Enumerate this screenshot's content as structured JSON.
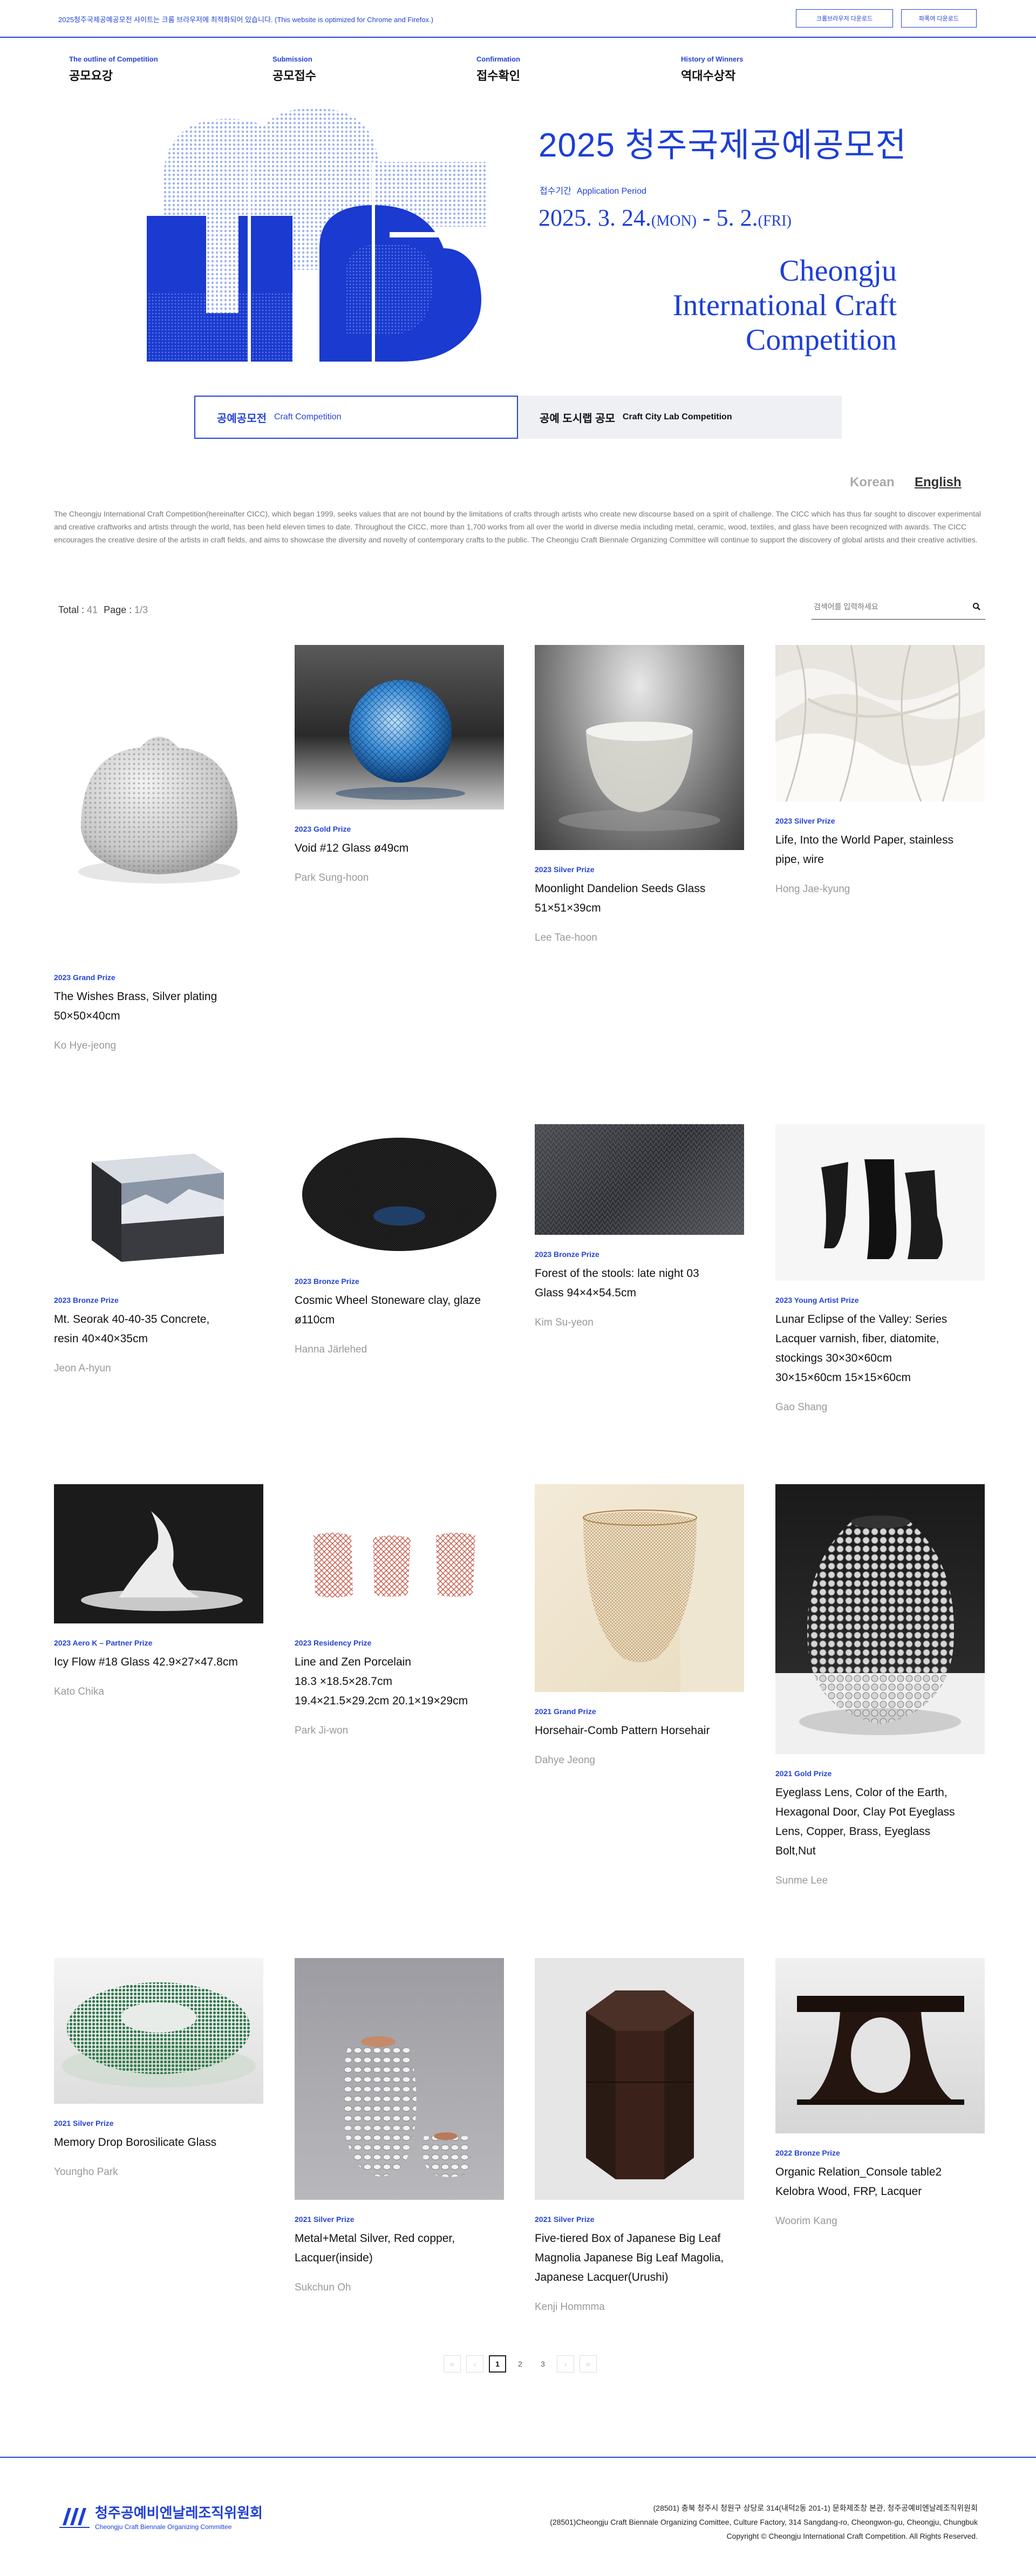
{
  "topbar": {
    "notice": "2025청주국제공예공모전 사이트는 크롬 브라우저에 최적화되어 있습니다. (This website is optimized for Chrome and Firefox.)",
    "download_chrome": "크롬브라우저 다운로드",
    "download_firefox": "파폭여 다운로드"
  },
  "nav": [
    {
      "en": "The outline of Competition",
      "ko": "공모요강"
    },
    {
      "en": "Submission",
      "ko": "공모접수"
    },
    {
      "en": "Confirmation",
      "ko": "접수확인"
    },
    {
      "en": "History of Winners",
      "ko": "역대수상작"
    }
  ],
  "hero": {
    "title": "2025 청주국제공예공모전",
    "period_label_ko": "접수기간",
    "period_label_en": "Application Period",
    "date_start": "2025. 3. 24.",
    "date_start_day": "(MON)",
    "date_sep": " - ",
    "date_end": "5. 2.",
    "date_end_day": "(FRI)",
    "en_line1": "Cheongju",
    "en_line2": "International Craft",
    "en_line3": "Competition",
    "colors": {
      "accent": "#1d3fd6",
      "light": "#a8b9f2"
    }
  },
  "tabs": [
    {
      "ko": "공예공모전",
      "en": "Craft Competition",
      "active": true
    },
    {
      "ko": "공예 도시랩 공모",
      "en": "Craft City Lab Competition",
      "active": false
    }
  ],
  "lang": {
    "korean": "Korean",
    "english": "English",
    "selected": "English"
  },
  "intro": "The Cheongju International Craft Competition(hereinafter CICC), which began 1999, seeks values that are not bound by the limitations of crafts through artists who create new discourse based on a spirit of challenge. The CICC which has thus far sought to discover experimental and creative craftworks and artists through the world, has been held eleven times to date. Throughout the CICC, more than 1,700 works from all over the world in diverse media including metal, ceramic, wood, textiles, and glass have been recognized with awards. The CICC encourages the creative desire of the artists in craft fields, and aims to showcase the diversity and novelty of contemporary crafts to the public. The Cheongju Craft Biennale Organizing Committee will continue to support the discovery of global artists and their creative activities.",
  "stats": {
    "total_label": "Total :",
    "total": "41",
    "page_label": "Page :",
    "page": "1/3"
  },
  "search": {
    "placeholder": "검색어를 입력하세요"
  },
  "works": [
    {
      "prize": "2023 Grand Prize",
      "title": "The Wishes Brass, Silver plating\n50×50×40cm",
      "artist": "Ko Hye-jeong"
    },
    {
      "prize": "2023 Gold Prize",
      "title": "Void #12 Glass ø49cm",
      "artist": "Park Sung-hoon"
    },
    {
      "prize": "2023 Silver Prize",
      "title": "Moonlight Dandelion Seeds Glass\n51×51×39cm",
      "artist": "Lee Tae-hoon"
    },
    {
      "prize": "2023 Silver Prize",
      "title": "Life, Into the World Paper, stainless\npipe, wire",
      "artist": "Hong Jae-kyung"
    },
    {
      "prize": "2023 Bronze Prize",
      "title": "Mt. Seorak 40-40-35 Concrete,\nresin 40×40×35cm",
      "artist": "Jeon A-hyun"
    },
    {
      "prize": "2023 Bronze Prize",
      "title": "Cosmic Wheel Stoneware clay, glaze\nø110cm",
      "artist": "Hanna Järlehed"
    },
    {
      "prize": "2023 Bronze Prize",
      "title": "Forest of the stools: late night 03\nGlass 94×4×54.5cm",
      "artist": "Kim Su-yeon"
    },
    {
      "prize": "2023 Young Artist Prize",
      "title": "Lunar Eclipse of the Valley: Series\nLacquer varnish, fiber, diatomite,\nstockings 30×30×60cm\n30×15×60cm 15×15×60cm",
      "artist": "Gao Shang"
    },
    {
      "prize": "2023 Aero K – Partner Prize",
      "title": "Icy Flow #18 Glass 42.9×27×47.8cm",
      "artist": "Kato Chika"
    },
    {
      "prize": "2023 Residency Prize",
      "title": "Line and Zen Porcelain\n18.3 ×18.5×28.7cm\n19.4×21.5×29.2cm 20.1×19×29cm",
      "artist": "Park Ji-won"
    },
    {
      "prize": "2021 Grand Prize",
      "title": "Horsehair-Comb Pattern Horsehair",
      "artist": "Dahye Jeong"
    },
    {
      "prize": "2021 Gold Prize",
      "title": "Eyeglass Lens, Color of the Earth,\nHexagonal Door, Clay Pot Eyeglass\nLens, Copper, Brass, Eyeglass\nBolt,Nut",
      "artist": "Sunme Lee"
    },
    {
      "prize": "2021 Silver Prize",
      "title": "Memory Drop Borosilicate Glass",
      "artist": "Youngho Park"
    },
    {
      "prize": "2021 Silver Prize",
      "title": "Metal+Metal Silver, Red copper,\nLacquer(inside)",
      "artist": "Sukchun Oh"
    },
    {
      "prize": "2021 Silver Prize",
      "title": "Five-tiered Box of Japanese Big Leaf\nMagnolia Japanese Big Leaf Magolia,\nJapanese Lacquer(Urushi)",
      "artist": "Kenji Hommma"
    },
    {
      "prize": "2022 Bronze Prize",
      "title": "Organic Relation_Console table2\nKelobra Wood, FRP, Lacquer",
      "artist": "Woorim Kang"
    }
  ],
  "pagination": {
    "first": "«",
    "prev": "‹",
    "pages": [
      "1",
      "2",
      "3"
    ],
    "current": "1",
    "next": "›",
    "last": "»"
  },
  "footer": {
    "org_ko": "청주공예비엔날레조직위원회",
    "org_en": "Cheongju Craft Biennale Organizing Committee",
    "addr_ko": "(28501) 충북 청주시 청원구 상당로 314(내덕2동 201-1) 문화제조창 본관, 청주공예비엔날레조직위원회",
    "addr_en": "(28501)Cheongju Craft Biennale Organizing Comittee, Culture Factory, 314 Sangdang-ro, Cheongwon-gu, Cheongju, Chungbuk",
    "copyright": "Copyright © Cheongju International Craft Competition. All Rights Reserved."
  }
}
